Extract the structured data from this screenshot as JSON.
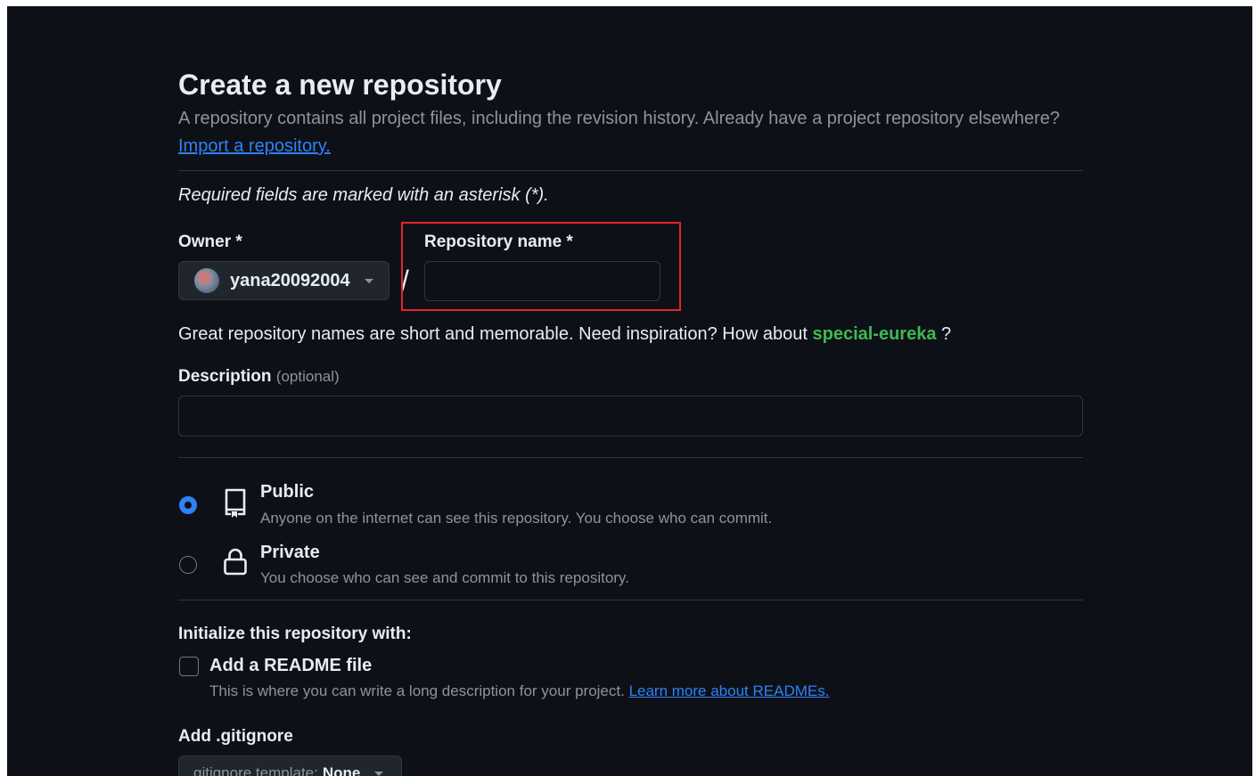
{
  "header": {
    "title": "Create a new repository",
    "subtitle": "A repository contains all project files, including the revision history. Already have a project repository elsewhere?",
    "import_link": "Import a repository."
  },
  "form": {
    "required_note": "Required fields are marked with an asterisk (*).",
    "owner": {
      "label": "Owner *",
      "value": "yana20092004"
    },
    "separator": "/",
    "repo_name": {
      "label": "Repository name *",
      "value": ""
    },
    "suggestion": {
      "prefix": "Great repository names are short and memorable. Need inspiration? How about",
      "name": "special-eureka",
      "suffix": " ?"
    },
    "description": {
      "label": "Description",
      "optional": "(optional)",
      "value": ""
    },
    "visibility": {
      "selected": "public",
      "options": [
        {
          "id": "public",
          "title": "Public",
          "desc": "Anyone on the internet can see this repository. You choose who can commit.",
          "icon": "repo-icon"
        },
        {
          "id": "private",
          "title": "Private",
          "desc": "You choose who can see and commit to this repository.",
          "icon": "lock-icon"
        }
      ]
    },
    "initialize": {
      "heading": "Initialize this repository with:",
      "readme": {
        "title": "Add a README file",
        "desc": "This is where you can write a long description for your project.",
        "link": "Learn more about READMEs.",
        "checked": false
      }
    },
    "gitignore": {
      "label": "Add .gitignore",
      "prefix": "gitignore template:",
      "value": "None"
    }
  },
  "colors": {
    "background": "#0d1117",
    "accent": "#2f81f7",
    "success": "#3fb950",
    "highlight": "#e5252b"
  }
}
